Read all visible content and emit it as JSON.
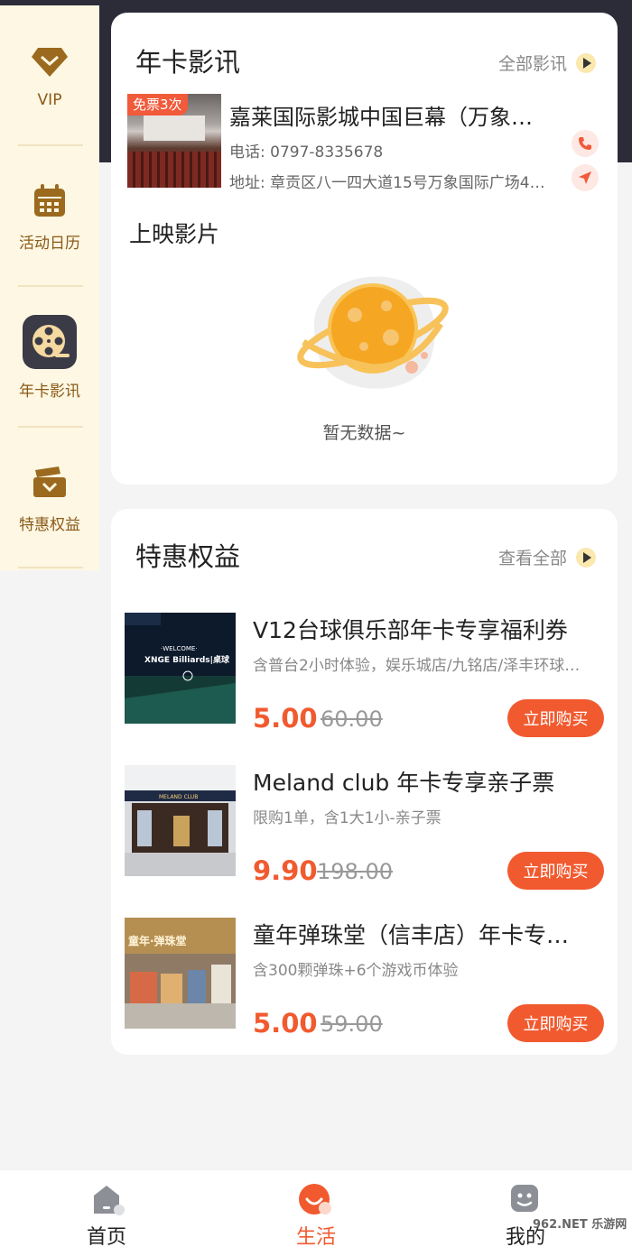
{
  "sidebar": {
    "items": [
      {
        "label": "VIP",
        "icon": "diamond-icon"
      },
      {
        "label": "活动日历",
        "icon": "calendar-icon"
      },
      {
        "label": "年卡影讯",
        "icon": "film-reel-icon",
        "active": true
      },
      {
        "label": "特惠权益",
        "icon": "ticket-icon"
      }
    ]
  },
  "movies_card": {
    "title": "年卡影讯",
    "more_label": "全部影讯",
    "cinema": {
      "badge": "免票3次",
      "name": "嘉莱国际影城中国巨幕（万象…",
      "phone": "电话: 0797-8335678",
      "address": "地址: 章贡区八一四大道15号万象国际广场4…"
    },
    "showing_title": "上映影片",
    "empty_text": "暂无数据~"
  },
  "benefits_card": {
    "title": "特惠权益",
    "more_label": "查看全部",
    "items": [
      {
        "title": "V12台球俱乐部年卡专享福利券",
        "desc": "含普台2小时体验，娱乐城店/九铭店/泽丰环球…",
        "price": "5.00",
        "orig_price": "60.00",
        "button": "立即购买"
      },
      {
        "title": "Meland club 年卡专享亲子票",
        "desc": "限购1单，含1大1小-亲子票",
        "price": "9.90",
        "orig_price": "198.00",
        "button": "立即购买"
      },
      {
        "title": "童年弹珠堂（信丰店）年卡专…",
        "desc": "含300颗弹珠+6个游戏币体验",
        "price": "5.00",
        "orig_price": "59.00",
        "button": "立即购买"
      }
    ]
  },
  "bottom_nav": {
    "items": [
      {
        "label": "首页"
      },
      {
        "label": "生活",
        "active": true
      },
      {
        "label": "我的"
      }
    ]
  },
  "watermark": "962.NET 乐游网",
  "colors": {
    "accent": "#f15a2f",
    "sidebar_bg": "#fdf7e3",
    "sidebar_text": "#8a5a19",
    "dark_header": "#2b2c38"
  }
}
